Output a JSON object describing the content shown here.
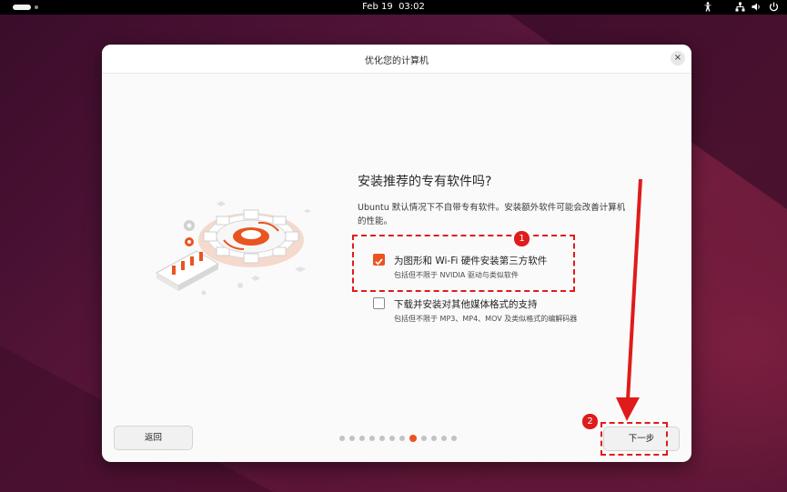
{
  "topbar": {
    "date": "Feb 19",
    "time": "03:02",
    "icons": [
      "accessibility-icon",
      "network-icon",
      "volume-icon",
      "power-icon"
    ]
  },
  "dialog": {
    "title": "优化您的计算机",
    "close_icon": "×",
    "heading": "安装推荐的专有软件吗?",
    "description": "Ubuntu 默认情况下不自带专有软件。安装额外软件可能会改善计算机的性能。",
    "options": [
      {
        "label": "为图形和 Wi-Fi 硬件安装第三方软件",
        "sub": "包括但不限于 NVIDIA 驱动与类似软件",
        "checked": true
      },
      {
        "label": "下载并安装对其他媒体格式的支持",
        "sub": "包括但不限于 MP3、MP4、MOV 及类似格式的编解码器",
        "checked": false
      }
    ],
    "back_label": "返回",
    "next_label": "下一步",
    "progress": {
      "total": 12,
      "current": 8
    }
  },
  "annotations": {
    "badge1": "1",
    "badge2": "2"
  },
  "colors": {
    "accent": "#e95420",
    "annotation": "#e01b1b"
  }
}
